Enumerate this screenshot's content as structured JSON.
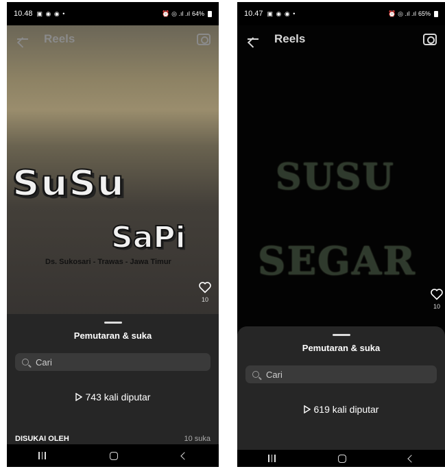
{
  "left": {
    "status": {
      "time": "10.48",
      "battery": "64%"
    },
    "header": {
      "title": "Reels"
    },
    "video": {
      "logo_line1": "SuSu",
      "logo_line2": "SaPi",
      "location": "Ds. Sukosari - Trawas - Jawa Timur"
    },
    "likes": {
      "count": "10"
    },
    "sheet": {
      "title": "Pemutaran & suka",
      "search_placeholder": "Cari",
      "plays_text": "743 kali diputar",
      "liked_by_label": "DISUKAI OLEH",
      "liked_count": "10 suka"
    }
  },
  "right": {
    "status": {
      "time": "10.47",
      "battery": "65%"
    },
    "header": {
      "title": "Reels"
    },
    "video": {
      "line1": "SUSU",
      "line2": "SEGAR"
    },
    "likes": {
      "count": "10"
    },
    "sheet": {
      "title": "Pemutaran & suka",
      "search_placeholder": "Cari",
      "plays_text": "619 kali diputar"
    }
  },
  "colors": {
    "sheet_bg": "#262626",
    "search_bg": "#3a3a3a",
    "status_bg": "#000000"
  },
  "icons": [
    "back-arrow-icon",
    "camera-icon",
    "heart-icon",
    "search-icon",
    "play-icon",
    "recent-apps-icon",
    "home-icon",
    "back-nav-icon"
  ]
}
